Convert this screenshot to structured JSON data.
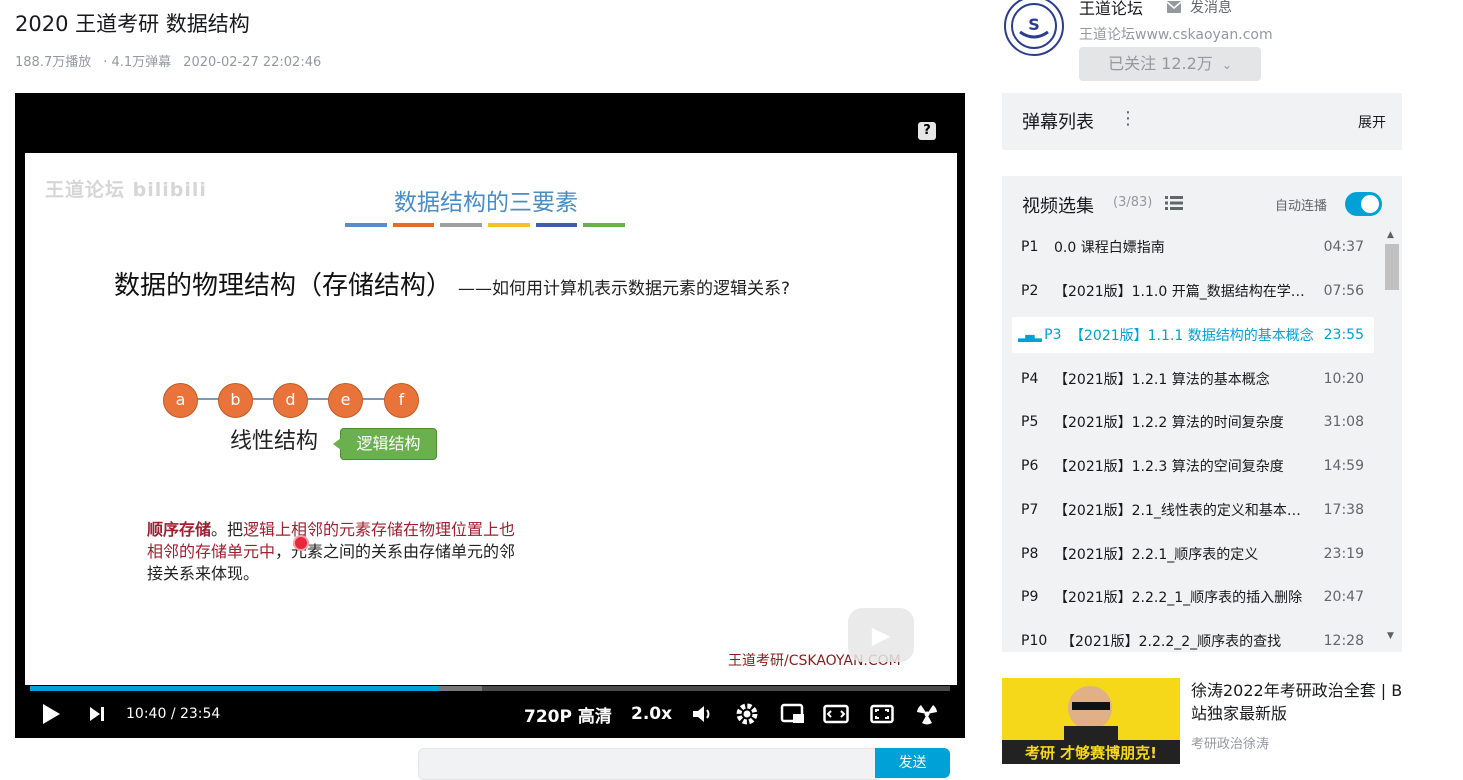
{
  "video": {
    "title": "2020 王道考研 数据结构",
    "views": "188.7万播放",
    "danmaku_count": "· 4.1万弹幕",
    "date": "2020-02-27 22:02:46"
  },
  "slide": {
    "watermark": "王道论坛 bilibili",
    "title": "数据结构的三要素",
    "underline_colors": [
      "#5b8cc6",
      "#e36c2c",
      "#9f9f9f",
      "#f2c12e",
      "#3e5fa8",
      "#6ab04c"
    ],
    "heading": "数据的物理结构（存储结构）",
    "heading_sub": "——如何用计算机表示数据元素的逻辑关系?",
    "nodes": [
      "a",
      "b",
      "d",
      "e",
      "f"
    ],
    "linear_label": "线性结构",
    "logic_tag": "逻辑结构",
    "para_term": "顺序存储",
    "para_1": "。把",
    "para_red": "逻辑上相邻的元素存储在物理位置上也相邻的存储单元中",
    "para_2": "，元素之间的关系由存储单元的邻接关系来体现。",
    "footer": "王道考研/CSKAOYAN.COM"
  },
  "player": {
    "current_time": "10:40",
    "separator": "/",
    "duration": "23:54",
    "progress_fraction": 0.446,
    "quality": "720P 高清",
    "speed": "2.0x",
    "help": "?"
  },
  "danmaku_bar": {
    "send": "发送"
  },
  "uploader": {
    "name": "王道论坛",
    "message": "发消息",
    "desc": "王道论坛www.cskaoyan.com",
    "follow": "已关注 12.2万"
  },
  "danmaku_panel": {
    "title": "弹幕列表",
    "expand": "展开"
  },
  "playlist": {
    "title": "视频选集",
    "count": "(3/83)",
    "autoplay": "自动连播",
    "items": [
      {
        "num": "P1",
        "title": "0.0 课程白嫖指南",
        "dur": "04:37"
      },
      {
        "num": "P2",
        "title": "【2021版】1.1.0 开篇_数据结构在学…",
        "dur": "07:56"
      },
      {
        "num": "P3",
        "title": "【2021版】1.1.1 数据结构的基本概念",
        "dur": "23:55"
      },
      {
        "num": "P4",
        "title": "【2021版】1.2.1 算法的基本概念",
        "dur": "10:20"
      },
      {
        "num": "P5",
        "title": "【2021版】1.2.2 算法的时间复杂度",
        "dur": "31:08"
      },
      {
        "num": "P6",
        "title": "【2021版】1.2.3 算法的空间复杂度",
        "dur": "14:59"
      },
      {
        "num": "P7",
        "title": "【2021版】2.1_线性表的定义和基本…",
        "dur": "17:38"
      },
      {
        "num": "P8",
        "title": "【2021版】2.2.1_顺序表的定义",
        "dur": "23:19"
      },
      {
        "num": "P9",
        "title": "【2021版】2.2.2_1_顺序表的插入删除",
        "dur": "20:47"
      },
      {
        "num": "P10",
        "title": "【2021版】2.2.2_2_顺序表的查找",
        "dur": "12:28"
      }
    ]
  },
  "ad": {
    "title": "徐涛2022年考研政治全套 | B站独家最新版",
    "author": "考研政治徐涛",
    "thumb_text": "考研 才够赛博朋克!"
  }
}
